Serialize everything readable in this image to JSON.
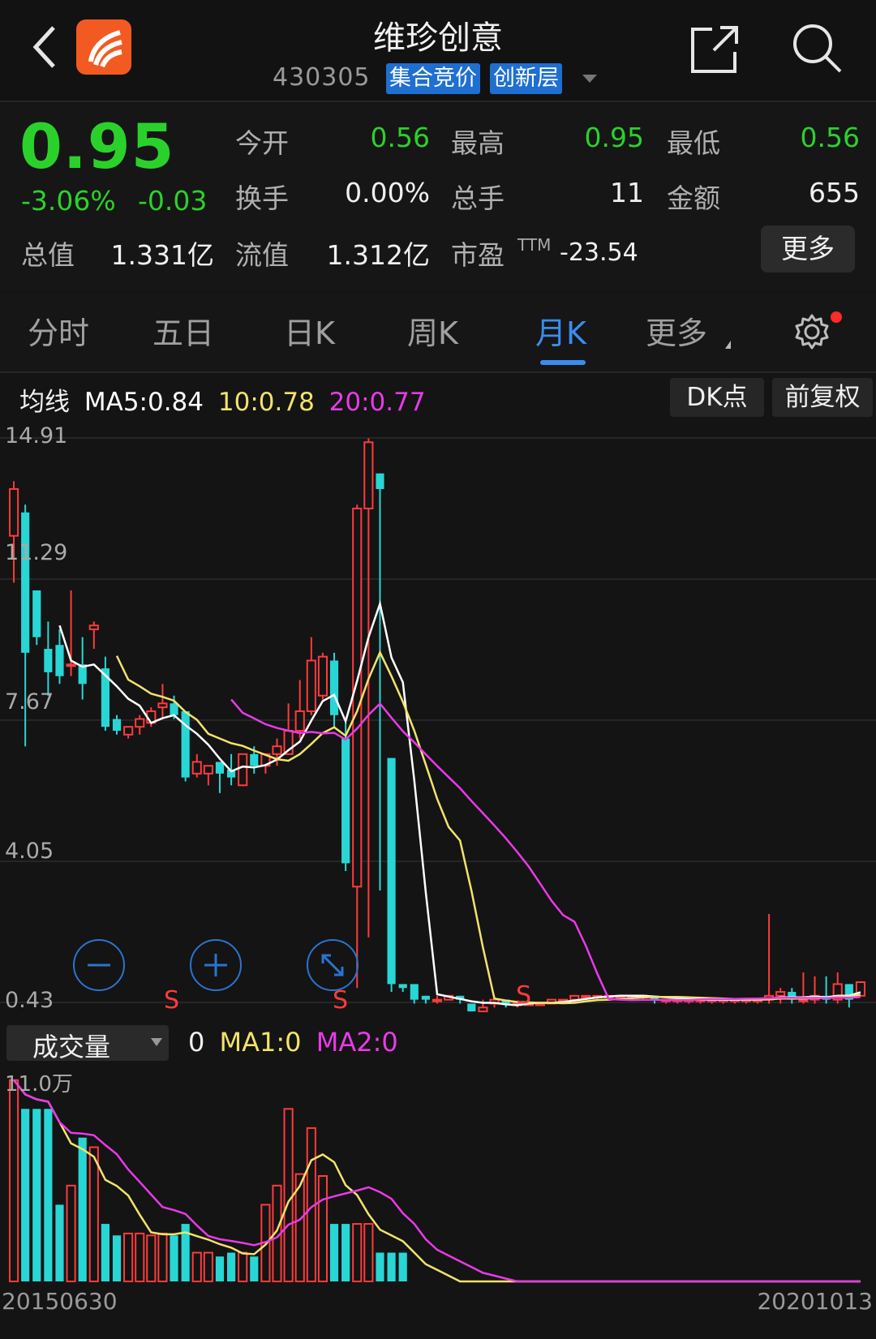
{
  "header": {
    "title": "维珍创意",
    "code": "430305",
    "tags": [
      "集合竞价",
      "创新层"
    ]
  },
  "quote": {
    "price": "0.95",
    "change_pct": "-3.06%",
    "change_abs": "-0.03",
    "rows": [
      [
        {
          "label": "今开",
          "value": "0.56",
          "color": "green"
        },
        {
          "label": "最高",
          "value": "0.95",
          "color": "green"
        },
        {
          "label": "最低",
          "value": "0.56",
          "color": "green"
        }
      ],
      [
        {
          "label": "换手",
          "value": "0.00%",
          "color": "white"
        },
        {
          "label": "总手",
          "value": "11",
          "color": "white"
        },
        {
          "label": "金额",
          "value": "655",
          "color": "white"
        }
      ]
    ],
    "total_value_label": "总值",
    "total_value": "1.331亿",
    "float_value_label": "流值",
    "float_value": "1.312亿",
    "pe_label": "市盈",
    "pe_sup": "TTM",
    "pe_value": "-23.54",
    "more_label": "更多"
  },
  "tabs": [
    {
      "label": "分时",
      "active": false
    },
    {
      "label": "五日",
      "active": false
    },
    {
      "label": "日K",
      "active": false
    },
    {
      "label": "周K",
      "active": false
    },
    {
      "label": "月K",
      "active": true
    },
    {
      "label": "更多",
      "active": false
    }
  ],
  "ma": {
    "prefix": "均线",
    "ma5": "MA5:0.84",
    "ma10": "10:0.78",
    "ma20": "20:0.77",
    "colors": {
      "ma5": "#ffffff",
      "ma10": "#f2e36b",
      "ma20": "#e83ae8"
    },
    "dk_label": "DK点",
    "adj_label": "前复权"
  },
  "volume": {
    "label": "成交量",
    "value": "0",
    "ma1": "MA1:0",
    "ma2": "MA2:0",
    "max_label": "11.0万"
  },
  "price_axis": [
    "14.91",
    "11.29",
    "7.67",
    "4.05",
    "0.43"
  ],
  "dates": {
    "start": "20150630",
    "end": "20201013"
  },
  "marks": [
    "S",
    "S",
    "S"
  ],
  "chart_data": {
    "type": "candlestick",
    "period": "monthly",
    "ylim": [
      0.43,
      14.91
    ],
    "y_ticks": [
      14.91,
      11.29,
      7.67,
      4.05,
      0.43
    ],
    "candles": [
      [
        12.4,
        13.6,
        11.2,
        13.8
      ],
      [
        13.0,
        9.4,
        7.0,
        13.2
      ],
      [
        11.0,
        9.8,
        9.6,
        10.0
      ],
      [
        9.5,
        8.9,
        8.3,
        10.2
      ],
      [
        9.6,
        8.8,
        8.6,
        10.0
      ],
      [
        9.1,
        9.1,
        8.8,
        11.0
      ],
      [
        9.1,
        8.6,
        8.2,
        9.8
      ],
      [
        10.0,
        10.1,
        9.5,
        10.2
      ],
      [
        9.0,
        7.5,
        7.4,
        9.3
      ],
      [
        7.7,
        7.4,
        7.3,
        7.8
      ],
      [
        7.3,
        7.5,
        7.2,
        7.5
      ],
      [
        7.5,
        7.7,
        7.3,
        7.8
      ],
      [
        7.6,
        7.9,
        7.5,
        8.0
      ],
      [
        8.0,
        8.1,
        7.7,
        8.6
      ],
      [
        8.1,
        7.8,
        7.7,
        8.3
      ],
      [
        7.9,
        6.2,
        6.1,
        7.9
      ],
      [
        6.3,
        6.6,
        6.2,
        6.8
      ],
      [
        6.3,
        6.5,
        6.0,
        6.4
      ],
      [
        6.6,
        6.3,
        5.8,
        6.6
      ],
      [
        6.4,
        6.2,
        6.0,
        6.8
      ],
      [
        6.0,
        6.8,
        6.0,
        6.8
      ],
      [
        6.8,
        6.5,
        6.3,
        7.0
      ],
      [
        6.5,
        6.8,
        6.3,
        6.8
      ],
      [
        6.8,
        7.0,
        6.5,
        7.2
      ],
      [
        6.8,
        7.4,
        6.8,
        8.1
      ],
      [
        7.4,
        7.9,
        7.2,
        8.7
      ],
      [
        7.9,
        9.2,
        7.8,
        9.8
      ],
      [
        8.3,
        9.3,
        8.2,
        9.4
      ],
      [
        9.2,
        7.8,
        7.5,
        9.4
      ],
      [
        7.2,
        4.0,
        3.8,
        7.6
      ],
      [
        3.4,
        13.1,
        0.8,
        13.2
      ],
      [
        13.1,
        14.8,
        2.1,
        14.9
      ],
      [
        14.0,
        13.6,
        3.3,
        14.0
      ],
      [
        6.7,
        0.9,
        0.7,
        6.7
      ],
      [
        0.9,
        0.8,
        0.7,
        0.9
      ],
      [
        0.9,
        0.5,
        0.4,
        0.9
      ],
      [
        0.6,
        0.5,
        0.4,
        0.6
      ],
      [
        0.5,
        0.5,
        0.4,
        0.6
      ],
      [
        0.5,
        0.6,
        0.5,
        0.6
      ],
      [
        0.6,
        0.5,
        0.4,
        0.6
      ],
      [
        0.4,
        0.2,
        0.2,
        0.4
      ],
      [
        0.2,
        0.3,
        0.2,
        0.5
      ],
      [
        0.4,
        0.5,
        0.3,
        0.6
      ],
      [
        0.5,
        0.4,
        0.3,
        0.5
      ],
      [
        0.4,
        0.4,
        0.3,
        0.4
      ],
      [
        0.4,
        0.4,
        0.4,
        0.4
      ],
      [
        0.4,
        0.4,
        0.4,
        0.4
      ],
      [
        0.4,
        0.5,
        0.4,
        0.5
      ],
      [
        0.5,
        0.5,
        0.4,
        0.5
      ],
      [
        0.5,
        0.6,
        0.4,
        0.6
      ],
      [
        0.6,
        0.6,
        0.5,
        0.6
      ],
      [
        0.6,
        0.6,
        0.5,
        0.6
      ],
      [
        0.6,
        0.6,
        0.5,
        0.6
      ],
      [
        0.6,
        0.6,
        0.5,
        0.6
      ],
      [
        0.6,
        0.6,
        0.5,
        0.6
      ],
      [
        0.6,
        0.6,
        0.5,
        0.6
      ],
      [
        0.6,
        0.5,
        0.4,
        0.6
      ],
      [
        0.5,
        0.5,
        0.4,
        0.5
      ],
      [
        0.5,
        0.5,
        0.4,
        0.5
      ],
      [
        0.5,
        0.5,
        0.4,
        0.5
      ],
      [
        0.5,
        0.5,
        0.4,
        0.5
      ],
      [
        0.5,
        0.5,
        0.4,
        0.5
      ],
      [
        0.5,
        0.5,
        0.4,
        0.5
      ],
      [
        0.5,
        0.5,
        0.4,
        0.5
      ],
      [
        0.5,
        0.5,
        0.4,
        0.5
      ],
      [
        0.5,
        0.5,
        0.4,
        0.5
      ],
      [
        0.5,
        0.6,
        0.4,
        2.7
      ],
      [
        0.6,
        0.7,
        0.4,
        0.8
      ],
      [
        0.7,
        0.5,
        0.4,
        0.8
      ],
      [
        0.5,
        0.5,
        0.4,
        1.2
      ],
      [
        0.5,
        0.6,
        0.4,
        1.1
      ],
      [
        0.6,
        0.5,
        0.4,
        1.1
      ],
      [
        0.5,
        0.9,
        0.4,
        1.2
      ],
      [
        0.9,
        0.5,
        0.3,
        0.9
      ],
      [
        0.6,
        0.95,
        0.6,
        0.95
      ]
    ],
    "volume": [
      10.5,
      9.0,
      9.0,
      9.0,
      4.0,
      5.0,
      7.5,
      7.0,
      3.0,
      2.4,
      2.5,
      2.5,
      2.4,
      2.5,
      2.4,
      3.0,
      1.5,
      1.5,
      1.3,
      1.5,
      1.5,
      1.3,
      4.0,
      5.0,
      9.0,
      5.6,
      8.0,
      5.5,
      3.0,
      3.0,
      3.0,
      3.0,
      1.5,
      1.5,
      1.5,
      0,
      0,
      0,
      0,
      0,
      0,
      0,
      0,
      0,
      0,
      0,
      0,
      0,
      0,
      0,
      0,
      0,
      0,
      0,
      0,
      0,
      0,
      0,
      0,
      0,
      0,
      0,
      0,
      0,
      0,
      0,
      0,
      0,
      0,
      0,
      0,
      0,
      0,
      0,
      0
    ],
    "volume_ylim": [
      0,
      11.0
    ]
  }
}
